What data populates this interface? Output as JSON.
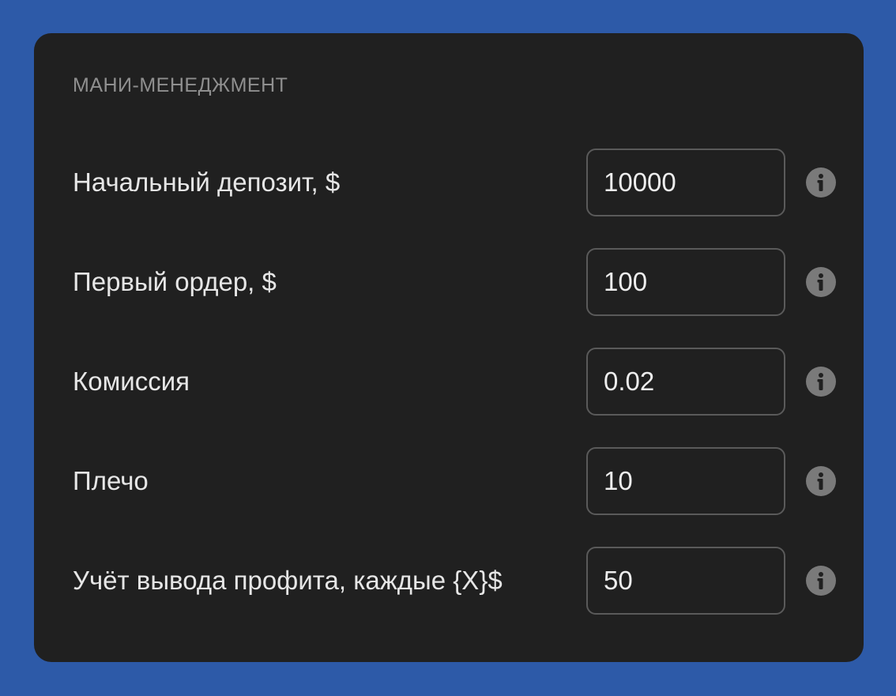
{
  "section": {
    "title": "Мани-менеджмент"
  },
  "fields": [
    {
      "label": "Начальный депозит, $",
      "value": "10000"
    },
    {
      "label": "Первый ордер, $",
      "value": "100"
    },
    {
      "label": "Комиссия",
      "value": "0.02"
    },
    {
      "label": "Плечо",
      "value": "10"
    },
    {
      "label": "Учёт вывода профита, каждые {X}$",
      "value": "50"
    }
  ],
  "icons": {
    "info": "info-icon"
  },
  "colors": {
    "background": "#2d5aa8",
    "panel": "#202020",
    "label": "#e6e6e6",
    "section_title": "#8f8f8f",
    "input_border": "#5a5a5a",
    "icon": "#7a7a7a"
  }
}
